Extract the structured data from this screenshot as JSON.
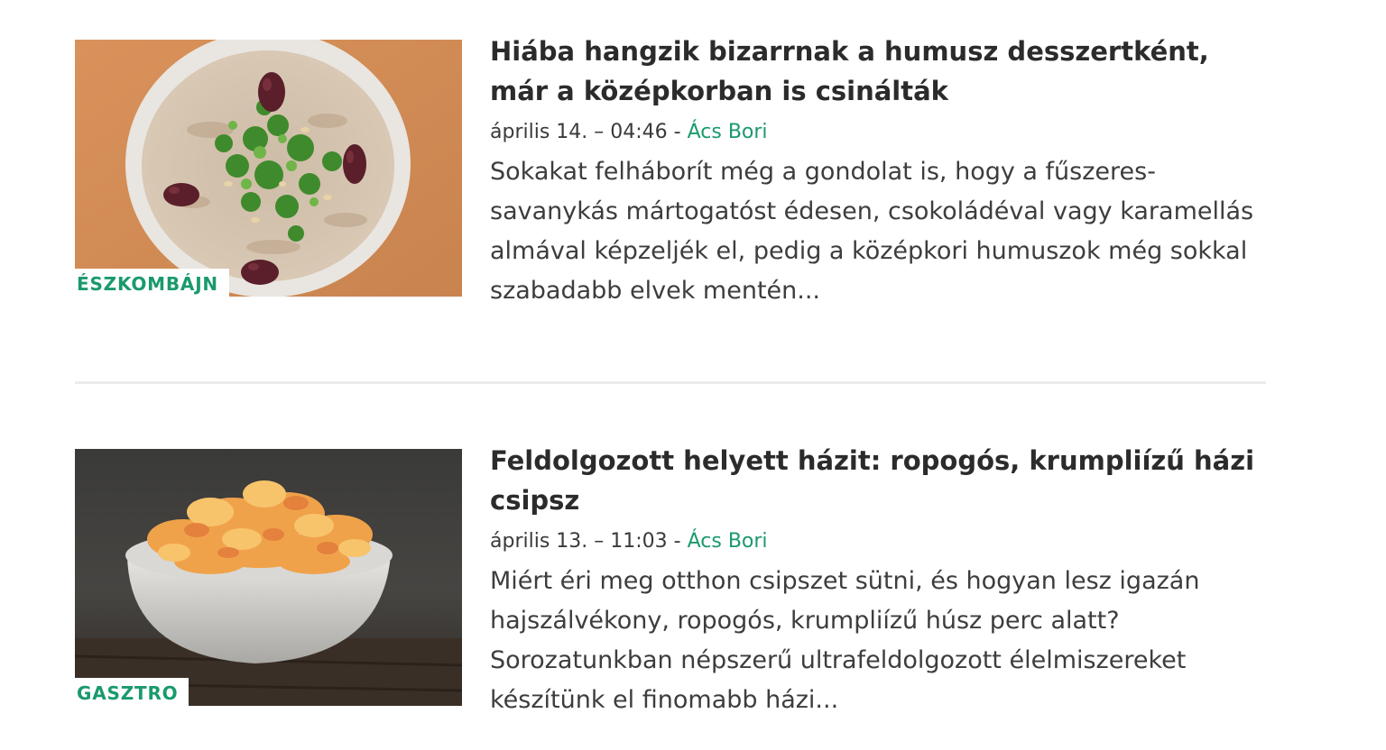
{
  "articles": [
    {
      "category": "ÉSZKOMBÁJN",
      "title": "Hiába hangzik bizarrnak a humusz desszertként, már a középkorban is csinálták",
      "date": "április 14. – 04:46",
      "separator": " - ",
      "author": "Ács Bori",
      "excerpt": "Sokakat felháborít még a gondolat is, hogy a fűszeres-savanykás mártogatóst édesen, csokoládéval vagy karamellás almával képzeljék el, pedig a középkori humuszok még sokkal szabadabb elvek mentén...",
      "image": "hummus-plate-photo"
    },
    {
      "category": "GASZTRO",
      "title": "Feldolgozott helyett házit: ropogós, krumpliízű házi csipsz",
      "date": "április 13. – 11:03",
      "separator": " - ",
      "author": "Ács Bori",
      "excerpt": "Miért éri meg otthon csipszet sütni, és hogyan lesz igazán hajszálvékony, ropogós, krumpliízű húsz perc alatt? Sorozatunkban népszerű ultrafeldolgozott élelmiszereket készítünk el finomabb házi...",
      "image": "potato-chips-bowl-photo"
    }
  ],
  "colors": {
    "accent": "#1a9a6c",
    "title": "#2b2b2b",
    "text": "#3d3d3d",
    "divider": "#ececec"
  }
}
